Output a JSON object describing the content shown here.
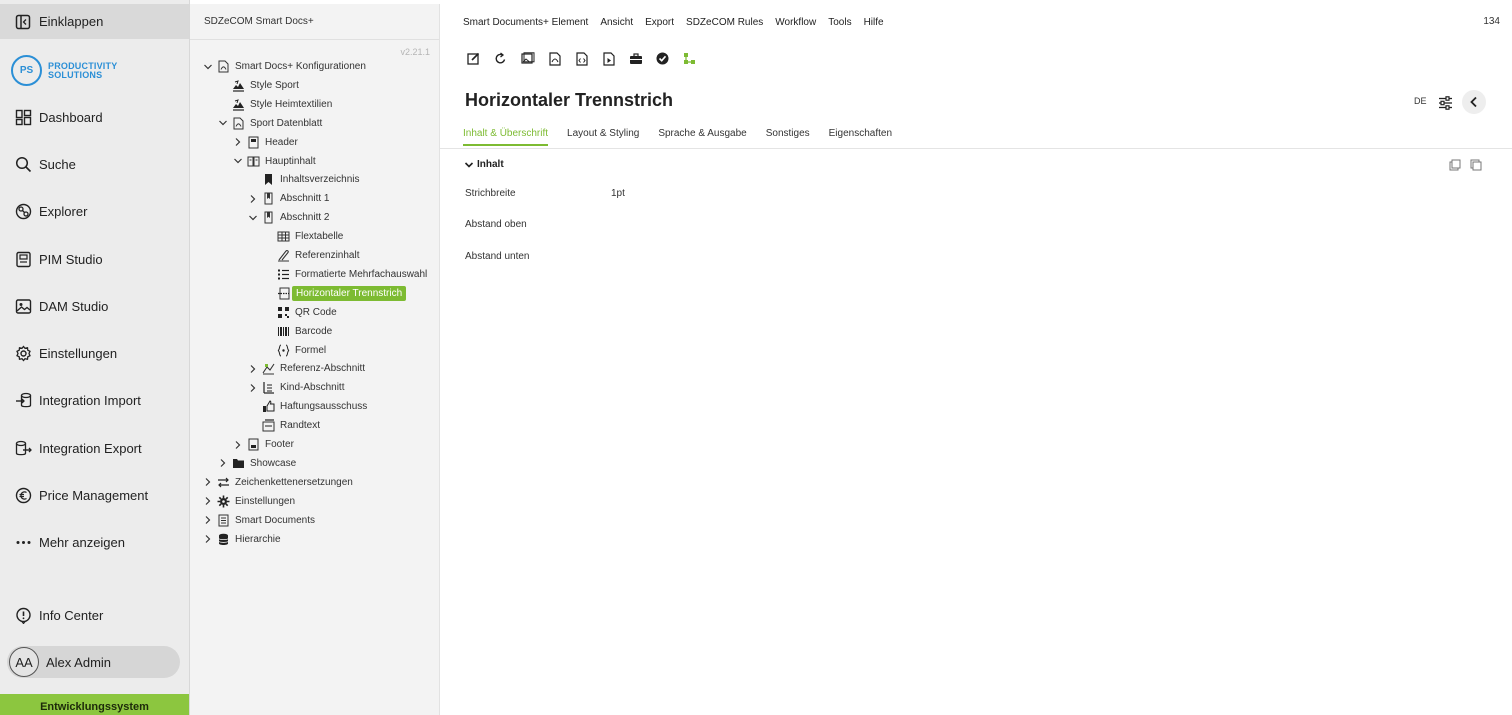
{
  "nav": {
    "collapse_label": "Einklappen",
    "logo_initials": "PS",
    "logo_line1": "PRODUCTIVITY",
    "logo_line2": "SOLUTIONS",
    "items": [
      {
        "label": "Dashboard",
        "icon": "dashboard-icon"
      },
      {
        "label": "Suche",
        "icon": "search-icon"
      },
      {
        "label": "Explorer",
        "icon": "explorer-icon"
      },
      {
        "label": "PIM Studio",
        "icon": "pim-icon"
      },
      {
        "label": "DAM Studio",
        "icon": "image-icon"
      },
      {
        "label": "Einstellungen",
        "icon": "gear-icon"
      },
      {
        "label": "Integration Import",
        "icon": "import-icon"
      },
      {
        "label": "Integration Export",
        "icon": "export-icon"
      },
      {
        "label": "Price Management",
        "icon": "euro-icon"
      },
      {
        "label": "Mehr anzeigen",
        "icon": "more-icon"
      }
    ],
    "info_center": "Info Center",
    "user_initials": "AA",
    "user_name": "Alex Admin",
    "environment": "Entwicklungssystem"
  },
  "tree": {
    "header": "SDZeCOM Smart Docs+",
    "version": "v2.21.1",
    "nodes": [
      {
        "label": "Smart Docs+ Konfigurationen",
        "expanded": true
      },
      {
        "label": "Style Sport"
      },
      {
        "label": "Style Heimtextilien"
      },
      {
        "label": "Sport Datenblatt",
        "expanded": true
      },
      {
        "label": "Header",
        "expanded": false
      },
      {
        "label": "Hauptinhalt",
        "expanded": true
      },
      {
        "label": "Inhaltsverzeichnis"
      },
      {
        "label": "Abschnitt 1",
        "expanded": false
      },
      {
        "label": "Abschnitt 2",
        "expanded": true
      },
      {
        "label": "Flextabelle"
      },
      {
        "label": "Referenzinhalt"
      },
      {
        "label": "Formatierte Mehrfachauswahl"
      },
      {
        "label": "Horizontaler Trennstrich",
        "selected": true
      },
      {
        "label": "QR Code"
      },
      {
        "label": "Barcode"
      },
      {
        "label": "Formel"
      },
      {
        "label": "Referenz-Abschnitt",
        "expanded": false
      },
      {
        "label": "Kind-Abschnitt",
        "expanded": false
      },
      {
        "label": "Haftungsausschuss"
      },
      {
        "label": "Randtext"
      },
      {
        "label": "Footer",
        "expanded": false
      },
      {
        "label": "Showcase",
        "expanded": false
      },
      {
        "label": "Zeichenkettenersetzungen",
        "expanded": false
      },
      {
        "label": "Einstellungen",
        "expanded": false
      },
      {
        "label": "Smart Documents",
        "expanded": false
      },
      {
        "label": "Hierarchie",
        "expanded": false
      }
    ]
  },
  "main": {
    "menu": [
      "Smart Documents+ Element",
      "Ansicht",
      "Export",
      "SDZeCOM Rules",
      "Workflow",
      "Tools",
      "Hilfe"
    ],
    "page_number": "134",
    "title": "Horizontaler Trennstrich",
    "language": "DE",
    "tabs": [
      "Inhalt & Überschrift",
      "Layout & Styling",
      "Sprache & Ausgabe",
      "Sonstiges",
      "Eigenschaften"
    ],
    "section_title": "Inhalt",
    "fields": [
      {
        "label": "Strichbreite",
        "value": "1pt"
      },
      {
        "label": "Abstand oben",
        "value": ""
      },
      {
        "label": "Abstand unten",
        "value": ""
      }
    ]
  },
  "colors": {
    "accent": "#7dbb32",
    "brand": "#2b8fd6",
    "env_bar": "#8cc63f"
  }
}
